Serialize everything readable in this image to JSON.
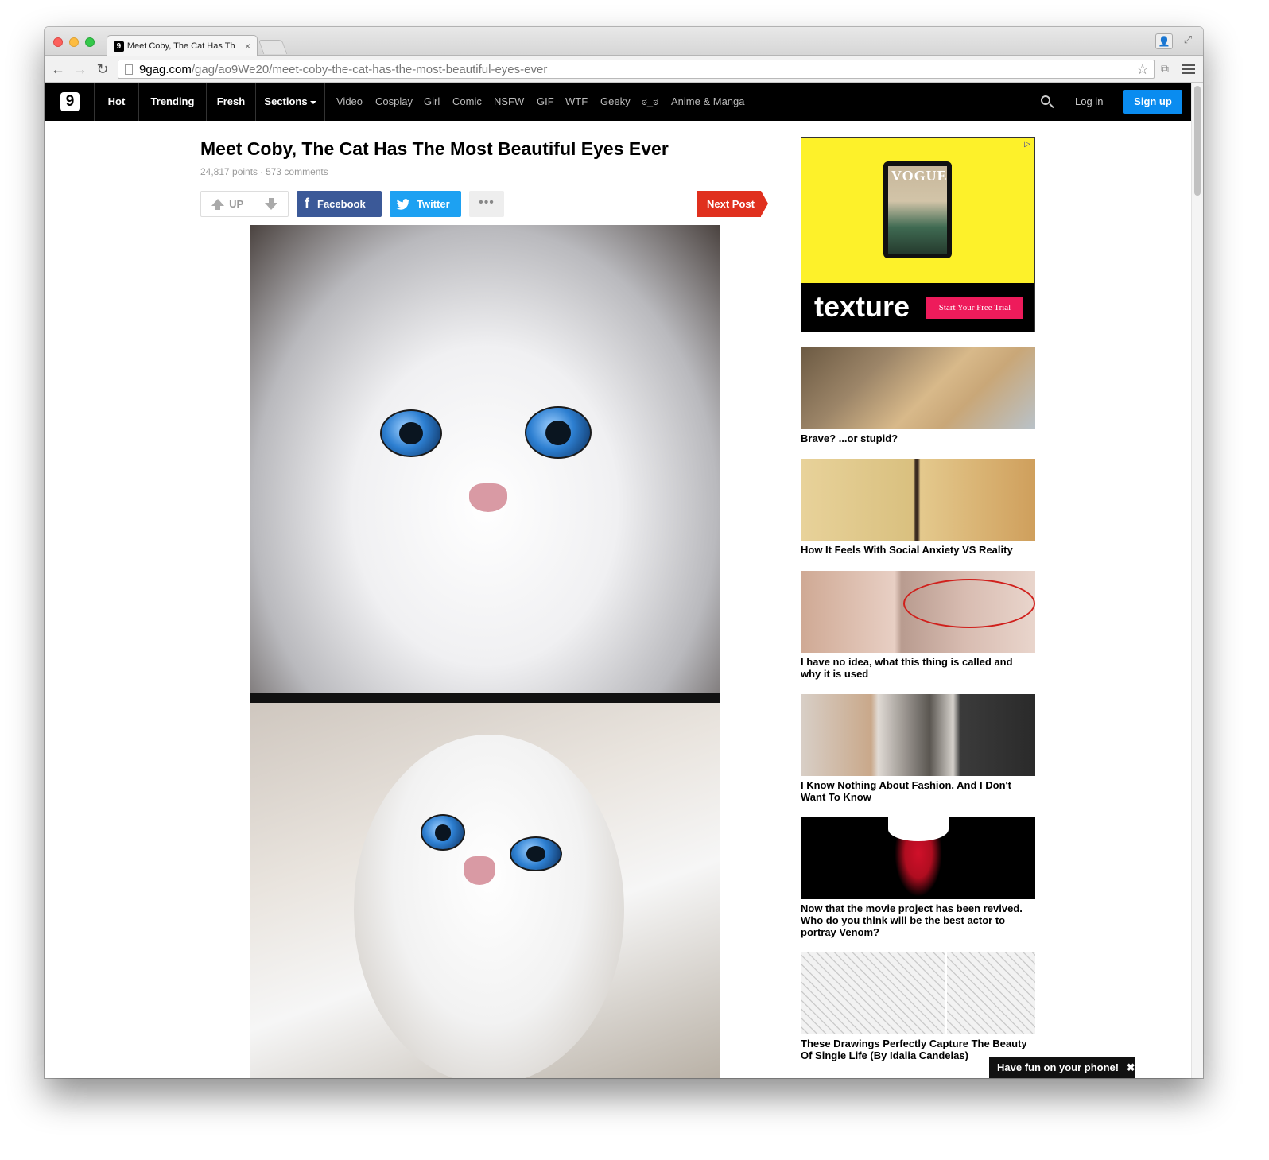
{
  "browser": {
    "tab_title": "Meet Coby, The Cat Has Th",
    "tab_close": "×",
    "url_domain": "9gag.com",
    "url_path": "/gag/ao9We20/meet-coby-the-cat-has-the-most-beautiful-eyes-ever"
  },
  "nav": {
    "logo": "9",
    "main_items": [
      "Hot",
      "Trending",
      "Fresh",
      "Sections"
    ],
    "sub_items": [
      "Video",
      "Cosplay",
      "Girl",
      "Comic",
      "NSFW",
      "GIF",
      "WTF",
      "Geeky",
      "ಠ_ಠ",
      "Anime & Manga"
    ],
    "login": "Log in",
    "signup": "Sign up"
  },
  "post": {
    "title": "Meet Coby, The Cat Has The Most Beautiful Eyes Ever",
    "points": "24,817 points",
    "separator": "·",
    "comments": "573 comments",
    "up_label": "UP",
    "facebook_label": "Facebook",
    "twitter_label": "Twitter",
    "more_label": "•••",
    "next_label": "Next Post"
  },
  "ad": {
    "magazine_word": "VOGUE",
    "brand": "texture",
    "cta": "Start Your Free Trial",
    "badge": "▷"
  },
  "sidebar": {
    "items": [
      {
        "caption": "Brave? ...or stupid?"
      },
      {
        "caption": "How It Feels With Social Anxiety VS Reality"
      },
      {
        "caption": "I have no idea, what this thing is called and why it is used"
      },
      {
        "caption": "I Know Nothing About Fashion. And I Don't Want To Know"
      },
      {
        "caption": "Now that the movie project has been revived. Who do you think will be the best actor to portray Venom?"
      },
      {
        "caption": "These Drawings Perfectly Capture The Beauty Of Single Life (By Idalia Candelas)"
      }
    ]
  },
  "toast": {
    "text": "Have fun on your phone!",
    "close": "✖"
  },
  "colors": {
    "nav_bg": "#000000",
    "signup": "#0a8cf0",
    "facebook": "#3b5998",
    "twitter": "#1da1f2",
    "next_post": "#e0301e",
    "ad_yellow": "#fdf12a",
    "ad_cta": "#ee1b5b"
  }
}
